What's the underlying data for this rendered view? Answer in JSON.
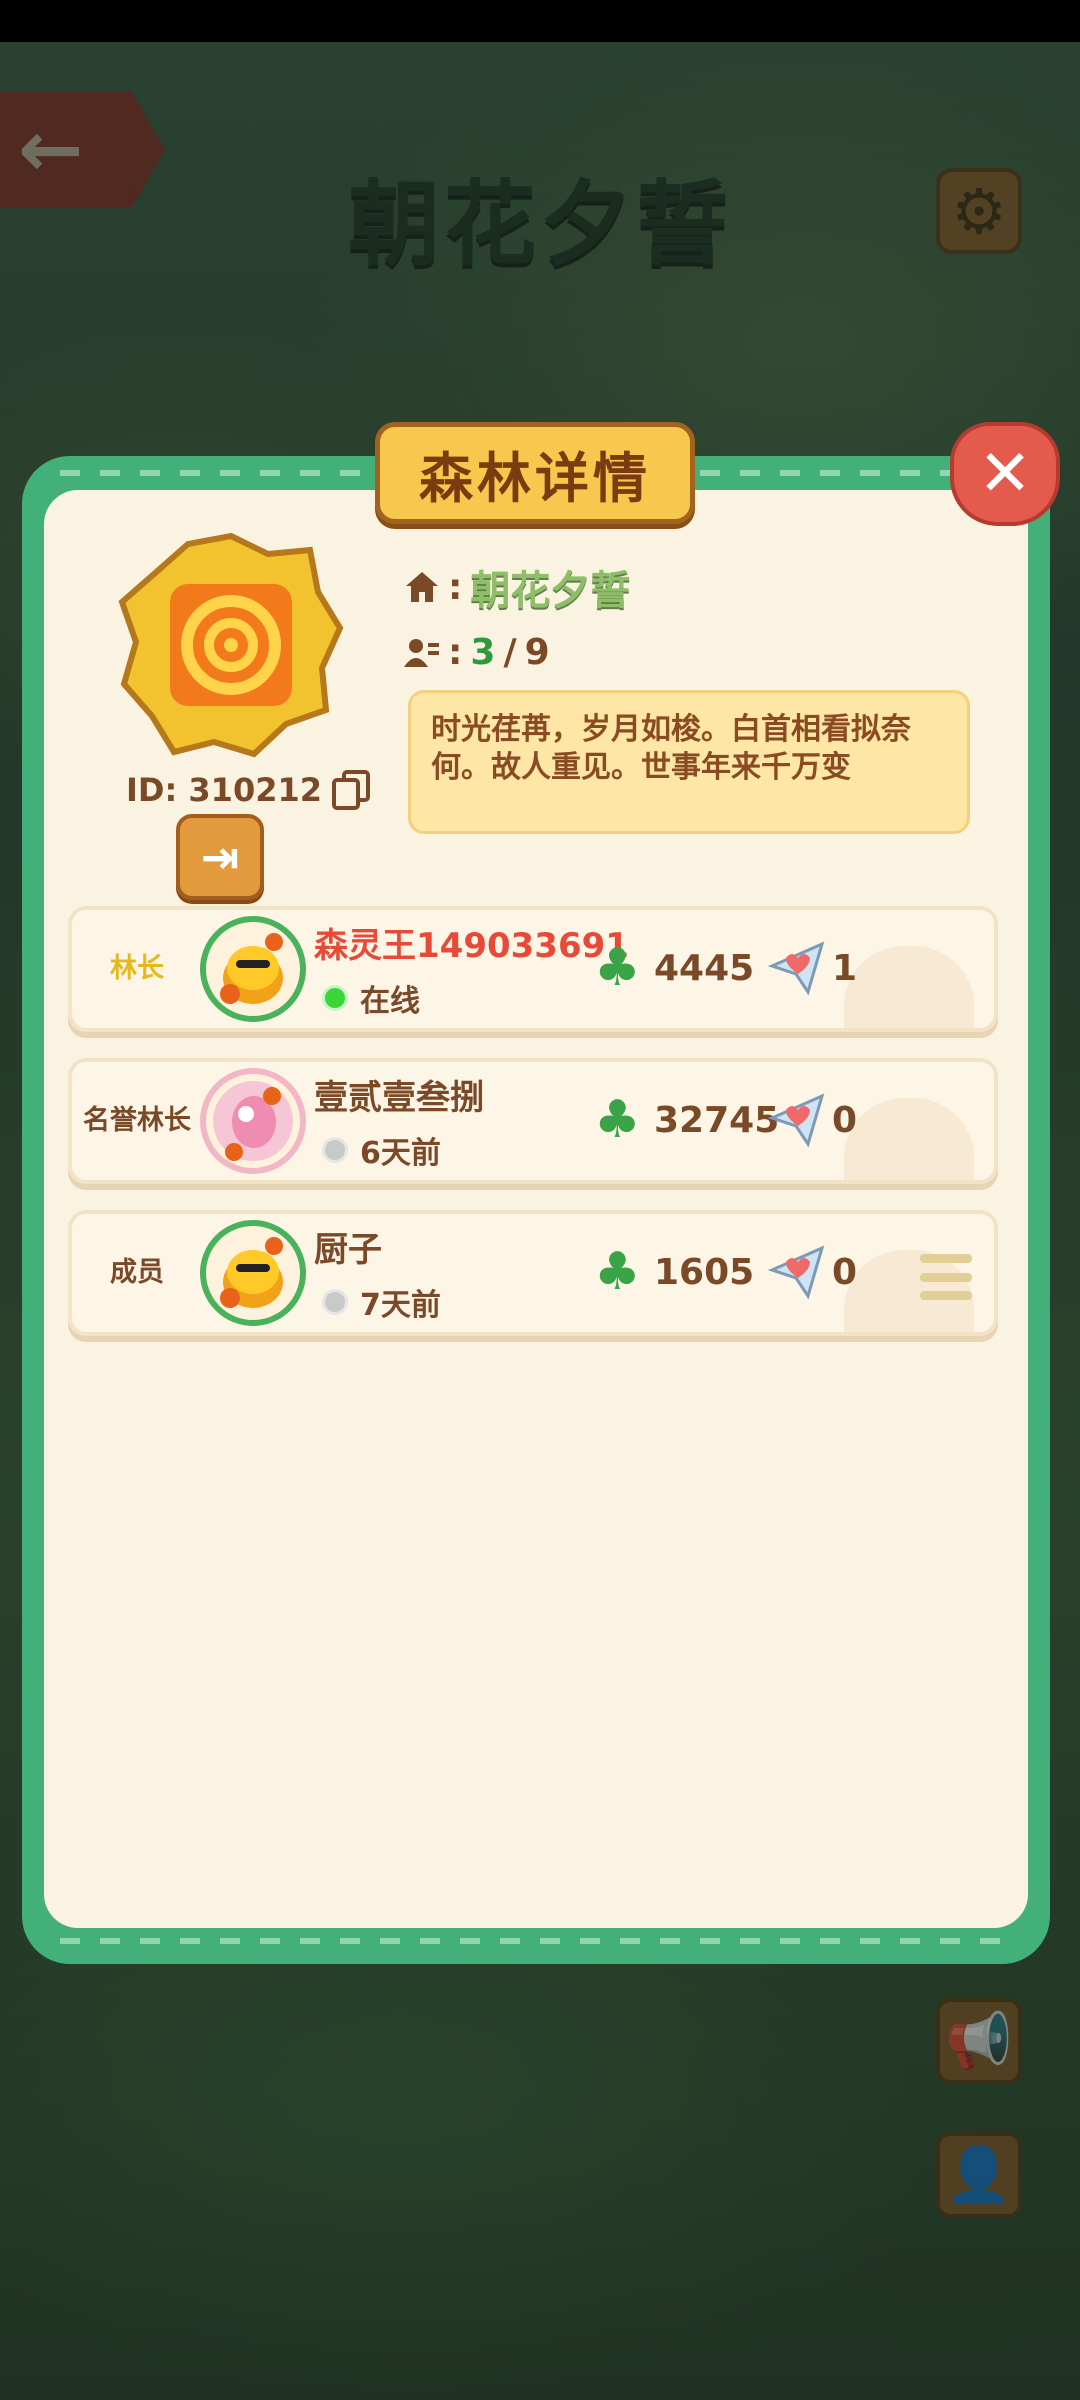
{
  "page": {
    "title": "朝花夕誓"
  },
  "dialog": {
    "title": "森林详情",
    "close_icon": "✕",
    "forest": {
      "id_label": "ID: 310212",
      "name": "朝花夕誓",
      "member_count_current": "3",
      "member_count_sep": "/",
      "member_count_max": "9",
      "description": "时光荏苒，岁月如梭。白首相看拟奈何。故人重见。世事年来千万变",
      "home_sep": ":",
      "people_sep": ":"
    },
    "members": [
      {
        "role": "林长",
        "name": "森灵王149033691",
        "status": "在线",
        "clovers": "4445",
        "likes": "1"
      },
      {
        "role": "名誉林长",
        "role_line1": "名誉",
        "role_line2": "林长",
        "name": "壹贰壹叁捌",
        "status": "6天前",
        "clovers": "32745",
        "likes": "0"
      },
      {
        "role": "成员",
        "name": "厨子",
        "status": "7天前",
        "clovers": "1605",
        "likes": "0"
      }
    ]
  },
  "icons": {
    "back": "arrow-left-icon",
    "settings": "gear-icon",
    "close": "close-icon",
    "home": "home-icon",
    "people": "people-icon",
    "copy": "copy-icon",
    "exit": "exit-icon",
    "clover": "clover-icon",
    "plane": "paper-plane-heart-icon",
    "menu": "menu-icon",
    "megaphone": "megaphone-icon",
    "profile": "profile-icon"
  },
  "colors": {
    "frame": "#43b07a",
    "panel": "#fbf3e2",
    "banner": "#f7c84e",
    "leader_role": "#e6b81f",
    "leader_name": "#e84a3a",
    "online": "#3bd43b"
  }
}
